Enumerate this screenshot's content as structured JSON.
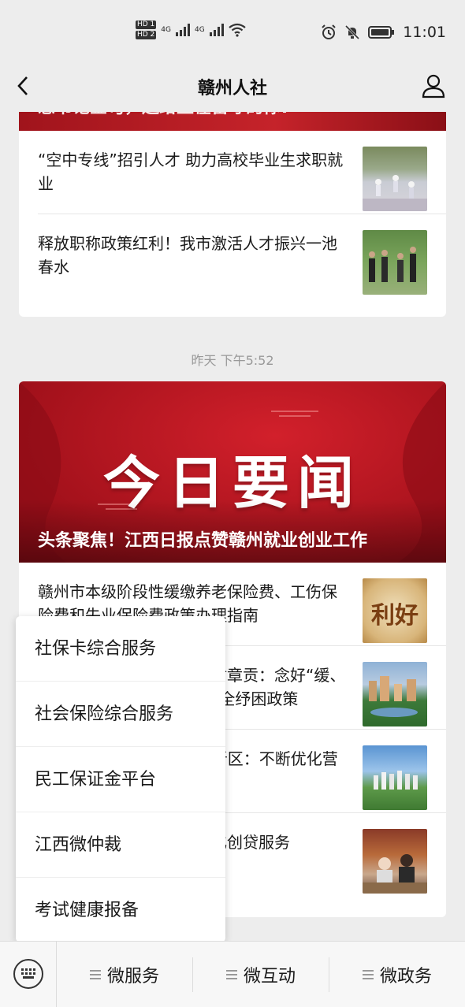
{
  "status_bar": {
    "time": "11:01",
    "hd1": "HD 1",
    "hd2": "HD 2",
    "net1": "4G",
    "net2": "4G"
  },
  "nav": {
    "title": "赣州人社"
  },
  "card1": {
    "top_title": "志书记金句，还给正在留守的你!",
    "items": [
      {
        "text": "“空中专线”招引人才 助力高校毕业生求职就业"
      },
      {
        "text": "释放职称政策红利！我市激活人才振兴一池春水"
      }
    ]
  },
  "timestamp": "昨天 下午5:52",
  "card2": {
    "banner_big": "今日要闻",
    "banner_caption": "头条聚焦！江西日报点赞赣州就业创业工作",
    "items": [
      {
        "text": "赣州市本级阶段性缓缴养老保险费、工伤保险费和失业保险费政策办理指南",
        "thumb_text": "利好"
      },
      {
        "text": "市人社局党组书记、局长谢章贡：念好“缓、减、返、补、降”五字诀，全纾困政策",
        "thumb_text": ""
      },
      {
        "text": "“人社服务快办行动”蓉江新区：不断优化营商环境",
        "thumb_text": ""
      },
      {
        "text": "赣州市创业担保贷款：优化创贷服务",
        "thumb_text": ""
      }
    ]
  },
  "popup_menu": {
    "items": [
      "社保卡综合服务",
      "社会保险综合服务",
      "民工保证金平台",
      "江西微仲裁",
      "考试健康报备"
    ]
  },
  "bottom_bar": {
    "tabs": [
      "微服务",
      "微互动",
      "微政务"
    ]
  }
}
